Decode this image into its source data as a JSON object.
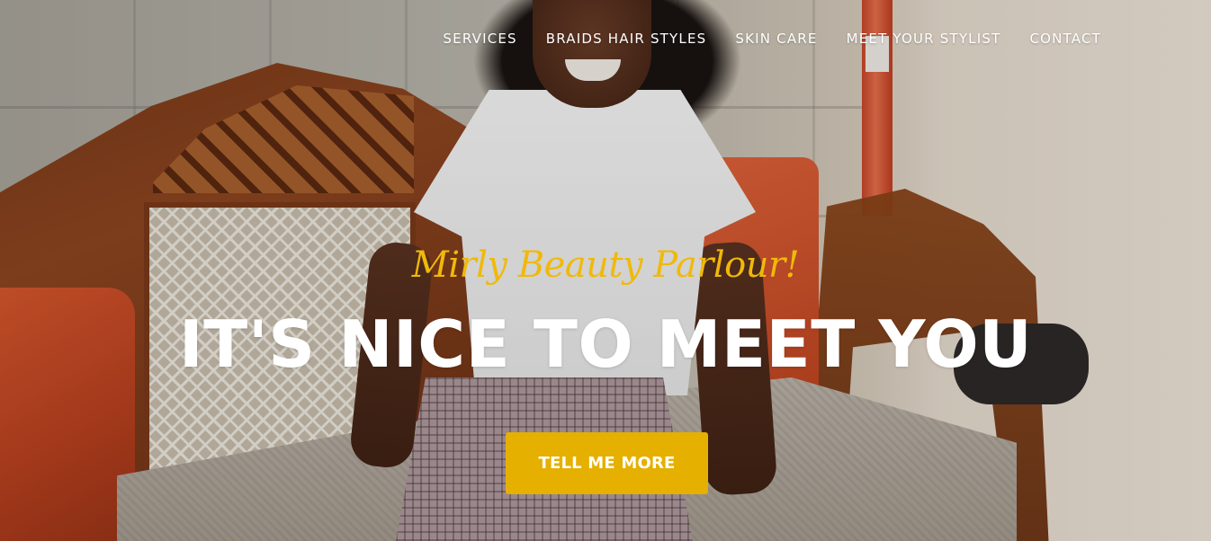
{
  "nav": {
    "items": [
      {
        "label": "SERVICES"
      },
      {
        "label": "BRAIDS HAIR STYLES"
      },
      {
        "label": "SKIN CARE"
      },
      {
        "label": "MEET YOUR STYLIST"
      },
      {
        "label": "CONTACT"
      }
    ]
  },
  "hero": {
    "subheading": "Mirly Beauty Parlour!",
    "heading": "IT'S NICE TO MEET YOU",
    "cta_label": "TELL ME MORE"
  },
  "colors": {
    "accent": "#e5b000",
    "subheading": "#f0b90a",
    "text": "#ffffff"
  }
}
